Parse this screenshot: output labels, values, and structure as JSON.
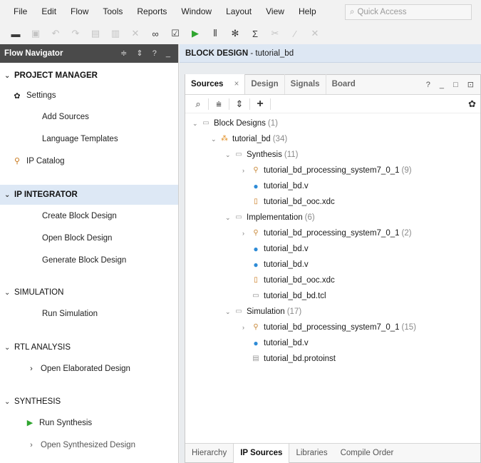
{
  "menu": {
    "items": [
      "File",
      "Edit",
      "Flow",
      "Tools",
      "Reports",
      "Window",
      "Layout",
      "View",
      "Help"
    ],
    "quick_access_placeholder": "Quick Access"
  },
  "toolbar": {
    "buttons": [
      "new-project",
      "save",
      "undo",
      "redo",
      "copy",
      "paste",
      "delete",
      "find",
      "validate",
      "run",
      "program",
      "settings",
      "sum",
      "cut",
      "autoconnect",
      "close"
    ]
  },
  "flow_navigator": {
    "title": "Flow Navigator",
    "header_icons": "≑ ⇕ ? _",
    "sections": [
      {
        "label": "PROJECT MANAGER",
        "items": [
          "Settings",
          "Add Sources",
          "Language Templates",
          "IP Catalog"
        ]
      },
      {
        "label": "IP INTEGRATOR",
        "items": [
          "Create Block Design",
          "Open Block Design",
          "Generate Block Design"
        ]
      },
      {
        "label": "SIMULATION",
        "items": [
          "Run Simulation"
        ]
      },
      {
        "label": "RTL ANALYSIS",
        "items": [
          "Open Elaborated Design"
        ]
      },
      {
        "label": "SYNTHESIS",
        "items": [
          "Run Synthesis",
          "Open Synthesized Design"
        ]
      }
    ]
  },
  "block_design": {
    "title_bold": "BLOCK DESIGN",
    "title_rest": " - tutorial_bd"
  },
  "sources_panel": {
    "tabs": [
      "Sources",
      "Design",
      "Signals",
      "Board"
    ],
    "close_glyph": "×",
    "window_controls": "? _ □ ⊡",
    "tree": [
      {
        "label": "Block Designs",
        "count": "(1)"
      },
      {
        "label": "tutorial_bd",
        "count": "(34)"
      },
      {
        "label": "Synthesis",
        "count": "(11)"
      },
      {
        "label": "tutorial_bd_processing_system7_0_1",
        "count": "(9)"
      },
      {
        "label": "tutorial_bd.v",
        "count": ""
      },
      {
        "label": "tutorial_bd_ooc.xdc",
        "count": ""
      },
      {
        "label": "Implementation",
        "count": "(6)"
      },
      {
        "label": "tutorial_bd_processing_system7_0_1",
        "count": "(2)"
      },
      {
        "label": "tutorial_bd.v",
        "count": ""
      },
      {
        "label": "tutorial_bd.v",
        "count": ""
      },
      {
        "label": "tutorial_bd_ooc.xdc",
        "count": ""
      },
      {
        "label": "tutorial_bd_bd.tcl",
        "count": ""
      },
      {
        "label": "Simulation",
        "count": "(17)"
      },
      {
        "label": "tutorial_bd_processing_system7_0_1",
        "count": "(15)"
      },
      {
        "label": "tutorial_bd.v",
        "count": ""
      },
      {
        "label": "tutorial_bd.protoinst",
        "count": ""
      }
    ],
    "bottom_tabs": [
      "Hierarchy",
      "IP Sources",
      "Libraries",
      "Compile Order"
    ]
  }
}
